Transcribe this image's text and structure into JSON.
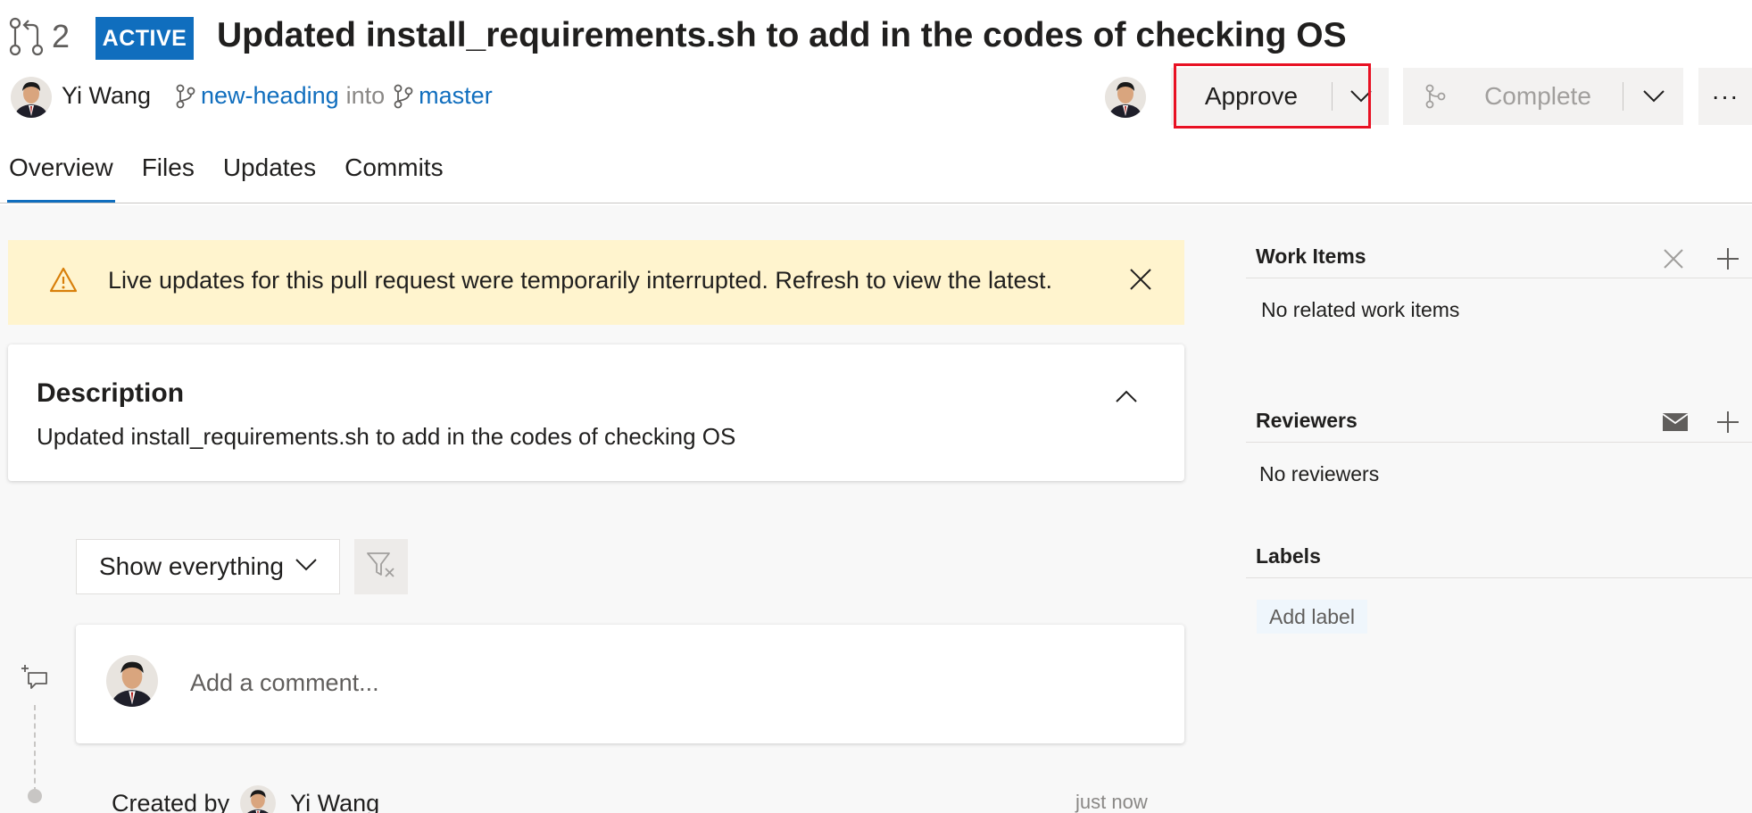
{
  "header": {
    "pr_icon": "pull-request-icon",
    "pr_id": "2",
    "status": "ACTIVE",
    "title": "Updated install_requirements.sh to add in the codes of checking OS",
    "author": "Yi Wang",
    "source_branch": "new-heading",
    "into_text": "into",
    "target_branch": "master",
    "approve_label": "Approve",
    "complete_label": "Complete",
    "more_label": "···"
  },
  "tabs": [
    {
      "label": "Overview",
      "active": true
    },
    {
      "label": "Files",
      "active": false
    },
    {
      "label": "Updates",
      "active": false
    },
    {
      "label": "Commits",
      "active": false
    }
  ],
  "banner": {
    "message": "Live updates for this pull request were temporarily interrupted. Refresh to view the latest."
  },
  "description": {
    "title": "Description",
    "text": "Updated install_requirements.sh to add in the codes of checking OS"
  },
  "filter": {
    "selected": "Show everything"
  },
  "comment": {
    "placeholder": "Add a comment..."
  },
  "activity": {
    "created_by_label": "Created by",
    "created_by_name": "Yi Wang",
    "time": "just now"
  },
  "sidebar": {
    "work_items": {
      "title": "Work Items",
      "empty": "No related work items"
    },
    "reviewers": {
      "title": "Reviewers",
      "empty": "No reviewers"
    },
    "labels": {
      "title": "Labels",
      "add_label": "Add label"
    }
  },
  "colors": {
    "accent": "#106ebe",
    "highlight": "#e81123",
    "banner_bg": "#fff4ce",
    "warning": "#d87f0a"
  }
}
